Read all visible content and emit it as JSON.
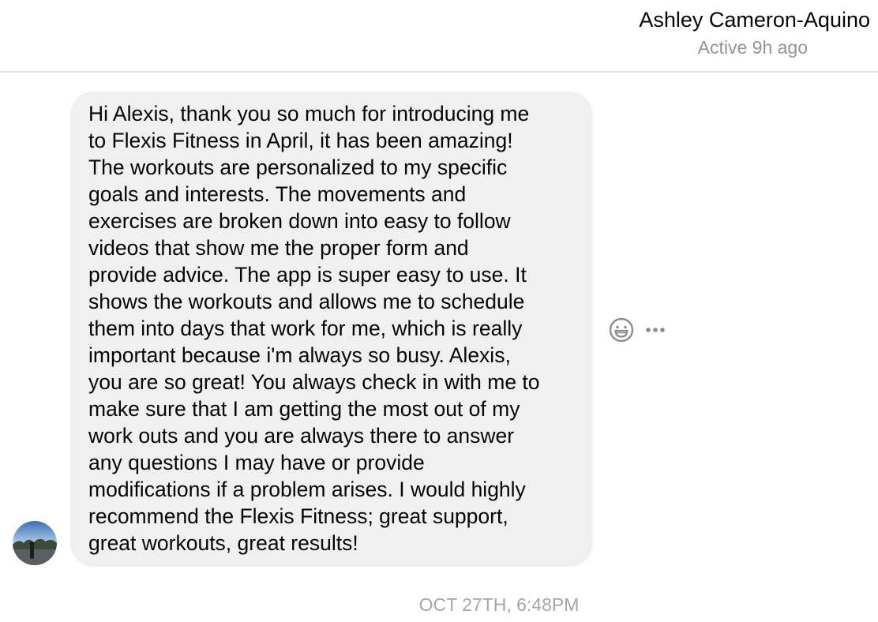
{
  "header": {
    "contact_name": "Ashley Cameron-Aquino",
    "status": "Active 9h ago"
  },
  "conversation": {
    "messages": [
      {
        "sender": "Ashley Cameron-Aquino",
        "text": "Hi Alexis, thank you so much for introducing me\nto Flexis Fitness in April, it has been amazing!\nThe workouts are personalized to my specific\ngoals and interests. The movements and\nexercises are broken down into easy to follow\nvideos that show me the proper form and\nprovide advice. The app is super easy to use. It\nshows the workouts and allows me to schedule\nthem into days that work for me, which is really\nimportant because i'm always so busy. Alexis,\nyou are so great! You always check in with me to\nmake sure that I am getting the most out of my\nwork outs and you are always there to answer\nany questions I may have or provide\nmodifications if a problem arises. I would highly\nrecommend the Flexis Fitness; great support,\ngreat workouts, great results!"
      }
    ],
    "timestamp": "OCT 27TH, 6:48PM"
  },
  "icons": {
    "reaction": "smiley-face-icon",
    "more": "more-options-icon",
    "avatar": "contact-avatar"
  },
  "colors": {
    "bubble_background": "#f0f0f0",
    "secondary_text": "#90949c",
    "timestamp_text": "#a3a7ad",
    "icon_gray": "#8a8d91"
  }
}
